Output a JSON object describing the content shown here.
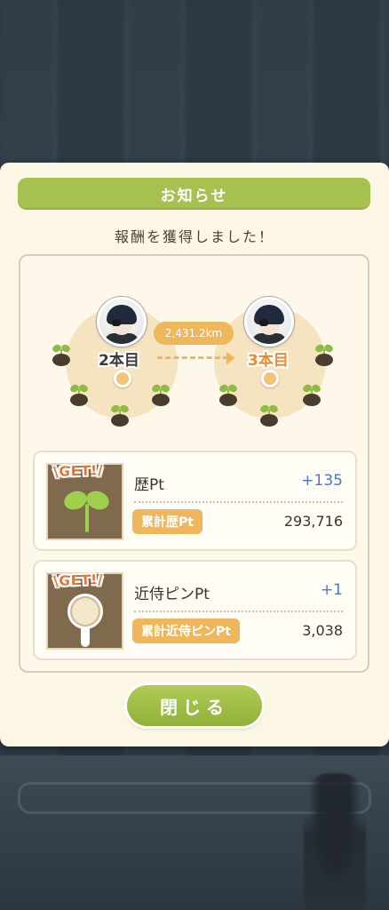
{
  "dialog": {
    "title": "お知らせ",
    "subtitle": "報酬を獲得しました！"
  },
  "route": {
    "current_stage": "2本目",
    "next_stage": "3本目",
    "distance": "2,431.2km"
  },
  "rewards": [
    {
      "badge": "\\GET!/",
      "name": "歴Pt",
      "gain": "+135",
      "total_label": "累計歴Pt",
      "total_value": "293,716",
      "icon": "sprout-icon"
    },
    {
      "badge": "\\GET!/",
      "name": "近侍ピンPt",
      "gain": "+1",
      "total_label": "累計近侍ピンPt",
      "total_value": "3,038",
      "icon": "pin-icon"
    }
  ],
  "buttons": {
    "close_label": "閉じる"
  },
  "colors": {
    "accent_green": "#a7c150",
    "accent_orange": "#eeb75c",
    "gain_blue": "#4a77c8",
    "panel_bg": "#fcf6e4"
  }
}
